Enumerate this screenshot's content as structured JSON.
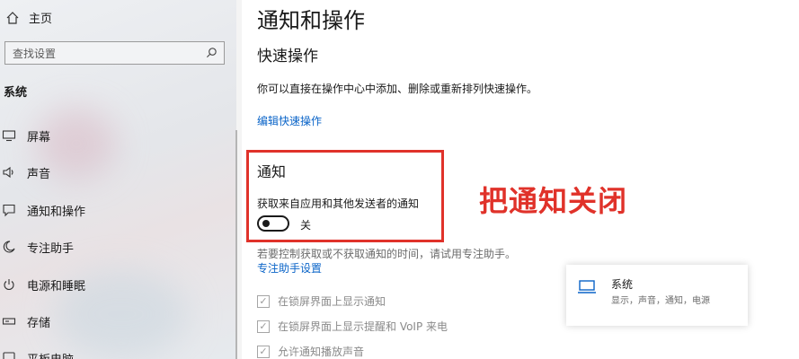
{
  "sidebar": {
    "home_label": "主页",
    "search_placeholder": "查找设置",
    "section_label": "系统",
    "items": [
      {
        "label": "屏幕",
        "icon": "monitor-icon"
      },
      {
        "label": "声音",
        "icon": "speaker-icon"
      },
      {
        "label": "通知和操作",
        "icon": "notification-icon"
      },
      {
        "label": "专注助手",
        "icon": "moon-icon"
      },
      {
        "label": "电源和睡眠",
        "icon": "power-icon"
      },
      {
        "label": "存储",
        "icon": "storage-icon"
      },
      {
        "label": "平板电脑",
        "icon": "tablet-icon"
      }
    ]
  },
  "main": {
    "title": "通知和操作",
    "quick_actions_heading": "快速操作",
    "quick_actions_desc": "你可以直接在操作中心中添加、删除或重新排列快速操作。",
    "edit_quick_actions_link": "编辑快速操作",
    "notifications_heading": "通知",
    "notifications_label": "获取来自应用和其他发送者的通知",
    "toggle_state": "关",
    "focus_hint": "若要控制获取或不获取通知的时间，请试用专注助手。",
    "focus_link": "专注助手设置",
    "checkboxes": [
      {
        "label": "在锁屏界面上显示通知",
        "checked": true
      },
      {
        "label": "在锁屏界面上显示提醒和 VoIP 来电",
        "checked": true
      },
      {
        "label": "允许通知播放声音",
        "checked": true
      }
    ]
  },
  "annotation": "把通知关闭",
  "card": {
    "title": "系统",
    "subtitle": "显示，声音，通知，电源",
    "icon": "laptop-icon"
  },
  "colors": {
    "accent_link": "#0a64c8",
    "highlight_red": "#e0322a"
  }
}
